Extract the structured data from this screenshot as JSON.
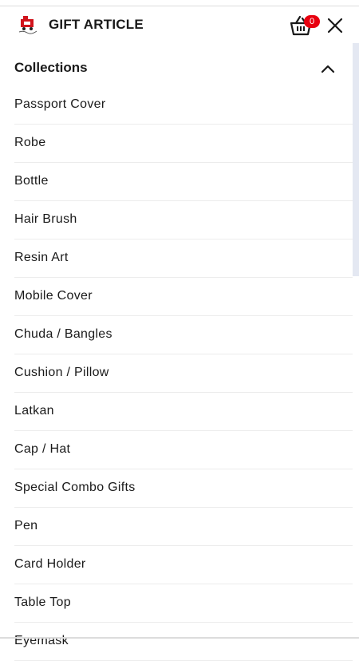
{
  "header": {
    "brand": "GIFT ARTICLE",
    "cart_count": "0",
    "logo_icon": "gift-cart-logo",
    "cart_icon": "basket-icon",
    "close_icon": "close-icon"
  },
  "menu": {
    "section_title": "Collections",
    "section_expanded": true,
    "items": [
      {
        "label": "Passport Cover"
      },
      {
        "label": "Robe"
      },
      {
        "label": "Bottle"
      },
      {
        "label": "Hair Brush"
      },
      {
        "label": "Resin Art"
      },
      {
        "label": "Mobile Cover"
      },
      {
        "label": "Chuda / Bangles"
      },
      {
        "label": "Cushion / Pillow"
      },
      {
        "label": "Latkan"
      },
      {
        "label": "Cap / Hat"
      },
      {
        "label": "Special Combo Gifts"
      },
      {
        "label": "Pen"
      },
      {
        "label": "Card Holder"
      },
      {
        "label": "Table Top"
      },
      {
        "label": "Eyemask"
      }
    ]
  },
  "colors": {
    "badge": "#e8000f",
    "text": "#1a1a1a",
    "divider": "#ececec",
    "scrollbar": "#e4e8f2"
  }
}
